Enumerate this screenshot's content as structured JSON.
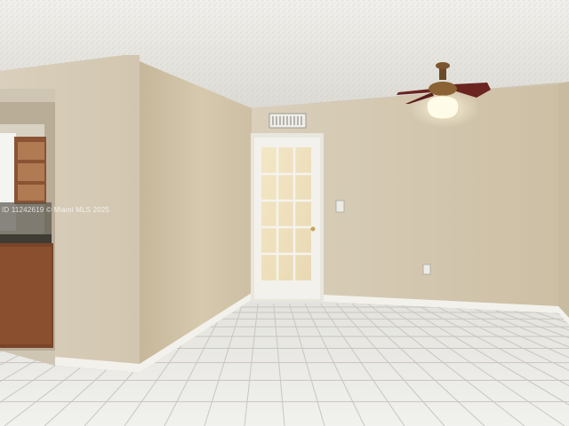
{
  "image": {
    "kind": "photo",
    "subject": "empty room with tiled floor, french door and ceiling fan",
    "watermark": "ID 11242619 © Miami MLS 2025"
  },
  "colors": {
    "ceiling": "#e7e6e2",
    "wall_left": "#cdbfa6",
    "wall_back": "#d8ceba",
    "wall_front": "#d1c6b1",
    "floor_tile": "#eaeae6",
    "grout": "#c9c6c0",
    "trim": "#f2f0ea",
    "door": "#f3f1ec",
    "cabinet": "#7a4428",
    "fan_blade": "#6b2420",
    "light_glow": "#fff6d8"
  }
}
